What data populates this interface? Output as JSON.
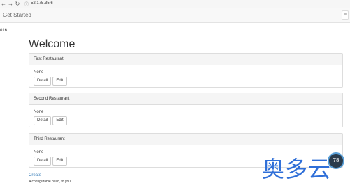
{
  "browser": {
    "back_icon": "arrow-left",
    "forward_icon": "arrow-right",
    "reload_icon": "reload",
    "url": "52.175.35.6"
  },
  "navbar": {
    "brand": "Get Started",
    "toggle_icon": "menu"
  },
  "side_text": "016",
  "main": {
    "title": "Welcome",
    "panels": [
      {
        "heading": "First Restaurant",
        "text": "None",
        "detail": "Detail",
        "edit": "Edit"
      },
      {
        "heading": "Second Restaurant",
        "text": "None",
        "detail": "Detail",
        "edit": "Edit"
      },
      {
        "heading": "Third Restaurant",
        "text": "None",
        "detail": "Detail",
        "edit": "Edit"
      }
    ],
    "create_link": "Create",
    "footer": "A configurable hello, to you!"
  },
  "overlay": {
    "watermark_text": "奥多云",
    "badge_text": "78"
  },
  "colors": {
    "link": "#337ab7",
    "watermark": "#2f6fd8"
  }
}
